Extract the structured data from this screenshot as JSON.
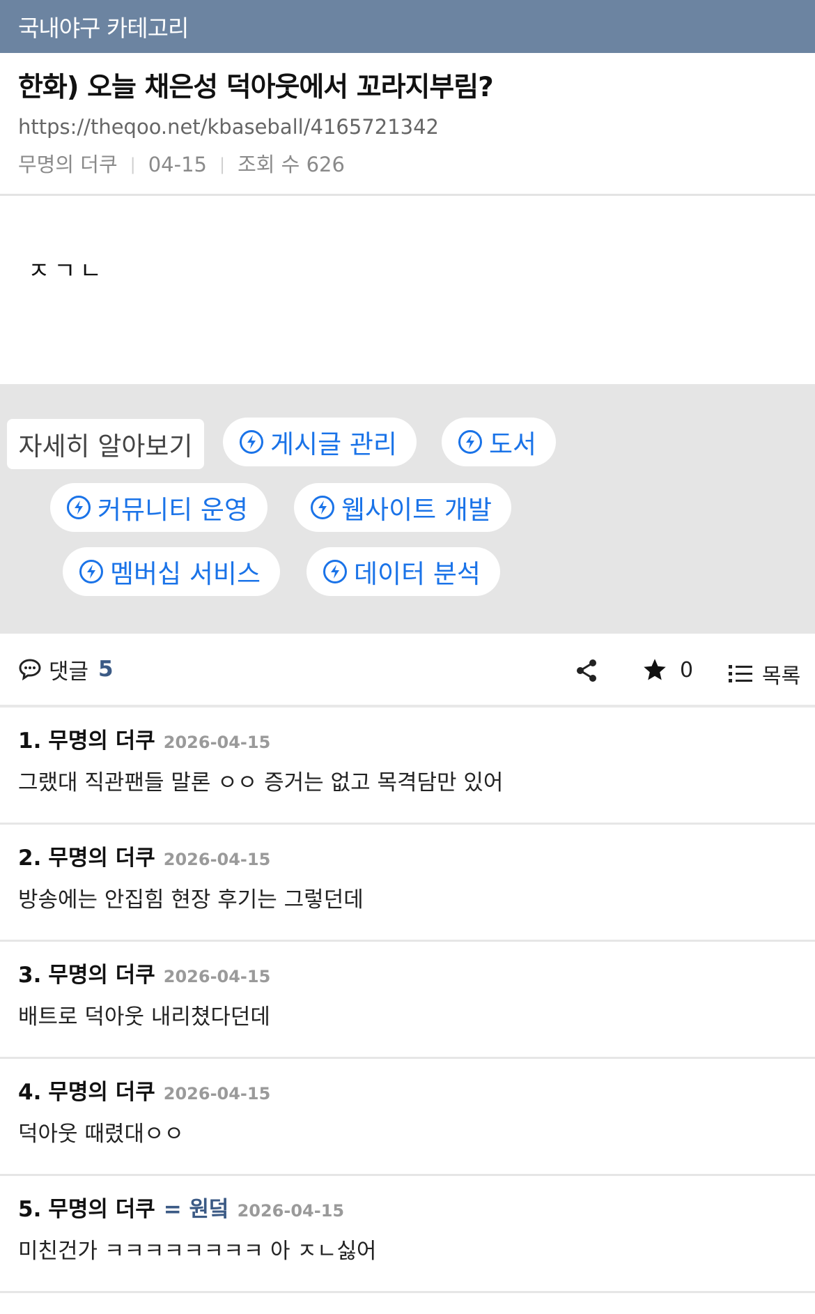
{
  "topbar": {
    "category": "국내야구 카테고리"
  },
  "post": {
    "title": "한화) 오늘 채은성 덕아웃에서 꼬라지부림?",
    "url": "https://theqoo.net/kbaseball/4165721342",
    "author": "무명의 더쿠",
    "date": "04-15",
    "views": "조회 수 626",
    "body": "ㅈㄱㄴ"
  },
  "ad": {
    "learn_more": "자세히 알아보기",
    "chips": [
      "게시글 관리",
      "도서",
      "커뮤니티 운영",
      "웹사이트 개발",
      "멤버십 서비스",
      "데이터 분석"
    ],
    "accent": "#1a73e8"
  },
  "comment_bar": {
    "label": "댓글",
    "count": "5",
    "star_count": "0",
    "list_label": "목록"
  },
  "comments": [
    {
      "num": "1.",
      "author": "무명의 더쿠",
      "badge": "",
      "date": "2026-04-15",
      "text": "그랬대 직관팬들 말론 ㅇㅇ 증거는 없고 목격담만 있어"
    },
    {
      "num": "2.",
      "author": "무명의 더쿠",
      "badge": "",
      "date": "2026-04-15",
      "text": "방송에는 안집힘 현장 후기는 그렇던데"
    },
    {
      "num": "3.",
      "author": "무명의 더쿠",
      "badge": "",
      "date": "2026-04-15",
      "text": "배트로 덕아웃 내리쳤다던데"
    },
    {
      "num": "4.",
      "author": "무명의 더쿠",
      "badge": "",
      "date": "2026-04-15",
      "text": "덕아웃 때렸대ㅇㅇ"
    },
    {
      "num": "5.",
      "author": "무명의 더쿠",
      "badge": "= 원덬",
      "date": "2026-04-15",
      "text": "미친건가 ㅋㅋㅋㅋㅋㅋㅋㅋ 아 ㅈㄴ싫어"
    }
  ],
  "colors": {
    "topbar": "#6c84a1",
    "link_accent": "#3b5a85"
  }
}
